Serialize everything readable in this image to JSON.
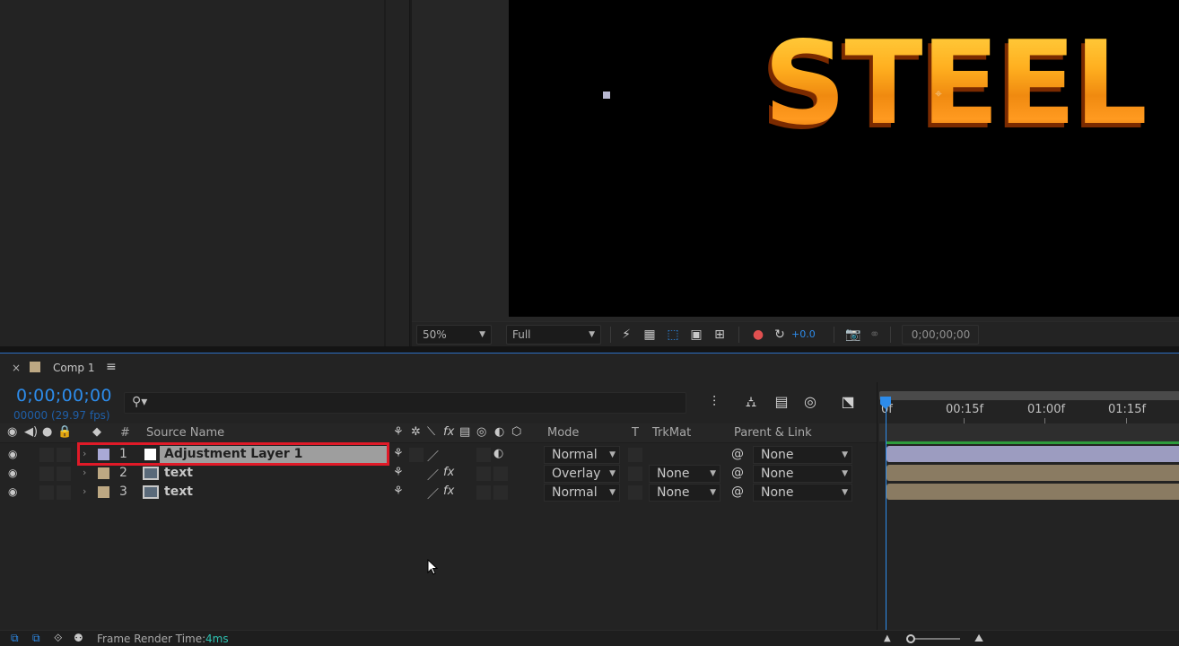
{
  "viewer": {
    "canvas_text": "STEEL",
    "zoom": "50%",
    "resolution": "Full",
    "exposure": "+0.0",
    "current_time": "0;00;00;00"
  },
  "tab": {
    "close": "×",
    "label": "Comp 1",
    "menu": "≡"
  },
  "timeline": {
    "timecode": "0;00;00;00",
    "fps": "00000 (29.97 fps)",
    "columns": {
      "num": "#",
      "source_name": "Source Name",
      "mode": "Mode",
      "t": "T",
      "trkmat": "TrkMat",
      "parent": "Parent & Link"
    },
    "layers": [
      {
        "num": "1",
        "name": "Adjustment Layer 1",
        "mode": "Normal",
        "trkmat": "",
        "parent": "None",
        "label_color": "#a9a9d6",
        "selected": true
      },
      {
        "num": "2",
        "name": "text",
        "mode": "Overlay",
        "trkmat": "None",
        "parent": "None",
        "label_color": "#bda883",
        "selected": false
      },
      {
        "num": "3",
        "name": "text",
        "mode": "Normal",
        "trkmat": "None",
        "parent": "None",
        "label_color": "#bda883",
        "selected": false
      }
    ],
    "ruler": [
      "0f",
      "00:15f",
      "01:00f",
      "01:15f"
    ]
  },
  "status": {
    "render_label": "Frame Render Time:",
    "render_value": "4ms"
  },
  "colors": {
    "accent_blue": "#2d8ceb",
    "highlight_red": "#e01a28",
    "adjustment_bar": "#9c9cc0",
    "text_bar": "#8a7b62"
  }
}
